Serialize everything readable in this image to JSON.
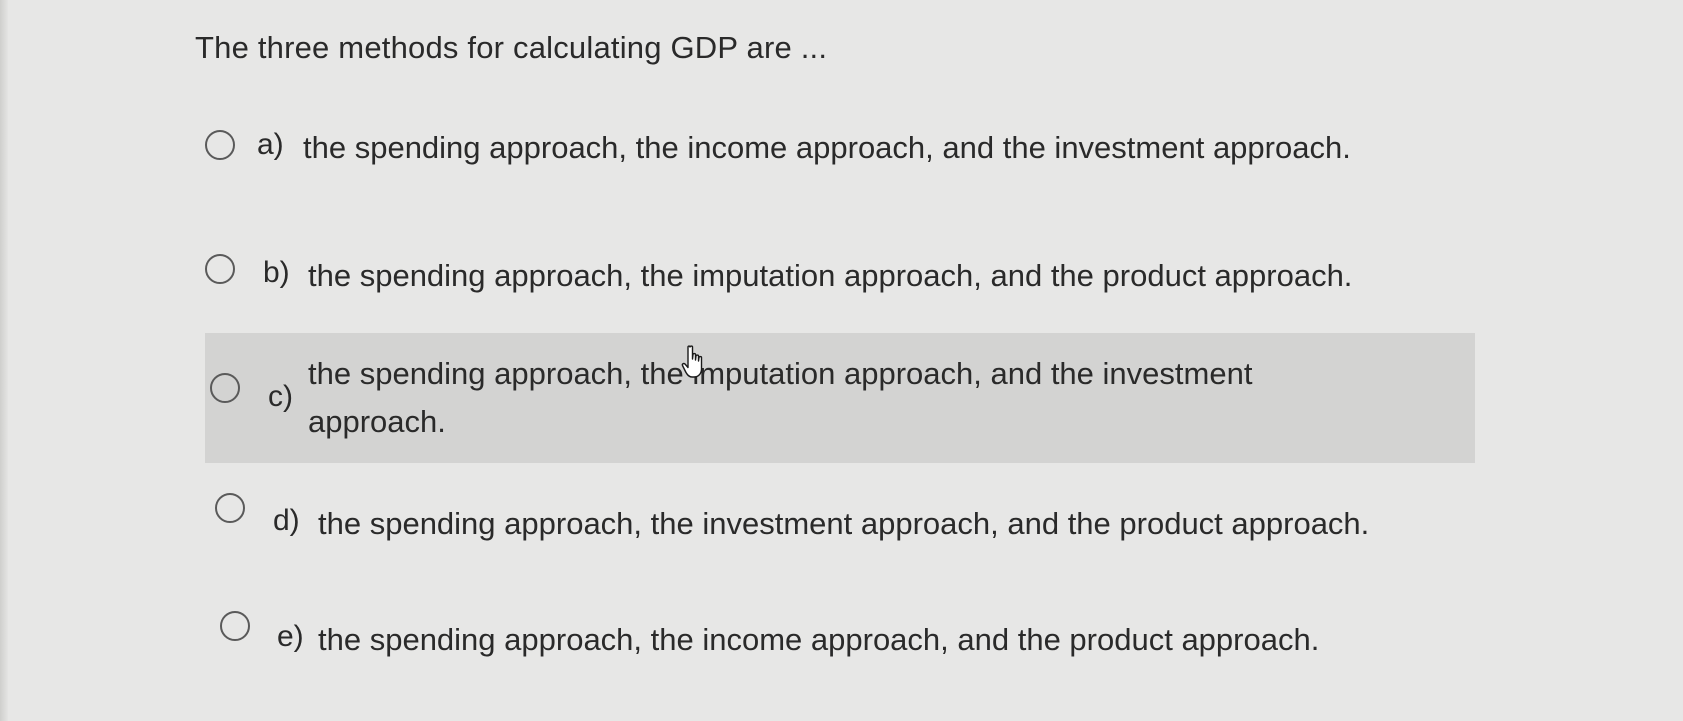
{
  "question": {
    "text": "The three methods for calculating GDP are ..."
  },
  "options": [
    {
      "letter": "a)",
      "text": "the spending approach, the income approach, and the investment approach."
    },
    {
      "letter": "b)",
      "text": "the spending approach, the imputation approach, and the product approach."
    },
    {
      "letter": "c)",
      "text": "the spending approach, the imputation approach, and the investment approach."
    },
    {
      "letter": "d)",
      "text": "the spending approach, the investment approach, and the product approach."
    },
    {
      "letter": "e)",
      "text": "the spending approach, the income approach, and the product approach."
    }
  ],
  "icons": {
    "cursor": "hand-pointer-icon",
    "radio": "radio-button-icon"
  },
  "colors": {
    "background": "#e7e7e6",
    "highlight": "#d3d3d2",
    "text": "#2a2a2a"
  }
}
